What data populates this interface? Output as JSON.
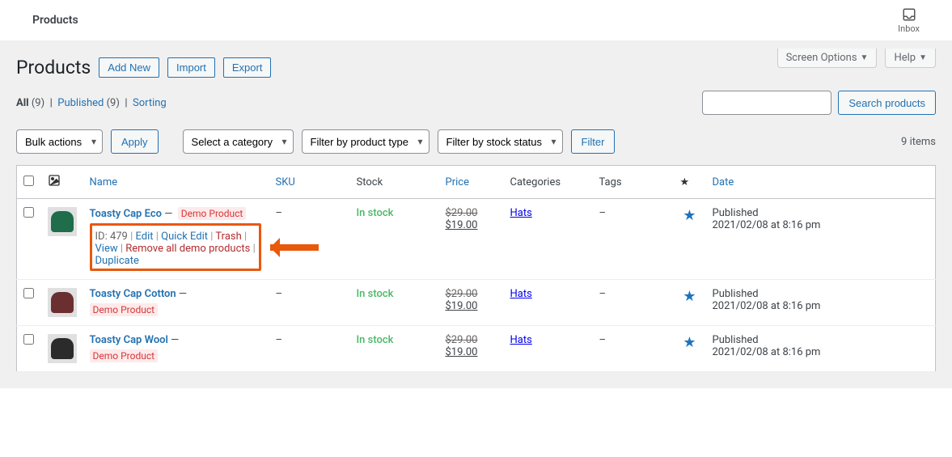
{
  "topbar": {
    "title": "Products",
    "inbox_label": "Inbox"
  },
  "screen_options": {
    "screen_options": "Screen Options",
    "help": "Help"
  },
  "page": {
    "heading": "Products",
    "btn_add_new": "Add New",
    "btn_import": "Import",
    "btn_export": "Export"
  },
  "views": {
    "all_label": "All",
    "all_count": "(9)",
    "published_label": "Published",
    "published_count": "(9)",
    "sorting_label": "Sorting"
  },
  "search": {
    "btn": "Search products"
  },
  "filters": {
    "bulk_actions": "Bulk actions",
    "apply": "Apply",
    "category": "Select a category",
    "product_type": "Filter by product type",
    "stock_status": "Filter by stock status",
    "filter_btn": "Filter",
    "items_label": "9 items"
  },
  "columns": {
    "name": "Name",
    "sku": "SKU",
    "stock": "Stock",
    "price": "Price",
    "categories": "Categories",
    "tags": "Tags",
    "date": "Date"
  },
  "row_actions": {
    "id_prefix": "ID: ",
    "edit": "Edit",
    "quick_edit": "Quick Edit",
    "trash": "Trash",
    "view": "View",
    "remove_demo": "Remove all demo products",
    "duplicate": "Duplicate"
  },
  "common": {
    "demo_badge": "Demo Product",
    "emdash": "—",
    "endash": "–",
    "sep": " | "
  },
  "rows": [
    {
      "id": "479",
      "title": "Toasty Cap Eco",
      "thumb_color": "#1f6d4a",
      "sku": "–",
      "stock": "In stock",
      "price_old": "$29.00",
      "price_new": "$19.00",
      "category": "Hats",
      "tags": "–",
      "date_line1": "Published",
      "date_line2": "2021/02/08 at 8:16 pm",
      "show_actions": true
    },
    {
      "title": "Toasty Cap Cotton",
      "thumb_color": "#6b2f2f",
      "sku": "–",
      "stock": "In stock",
      "price_old": "$29.00",
      "price_new": "$19.00",
      "category": "Hats",
      "tags": "–",
      "date_line1": "Published",
      "date_line2": "2021/02/08 at 8:16 pm",
      "show_actions": false
    },
    {
      "title": "Toasty Cap Wool",
      "thumb_color": "#2b2b2b",
      "sku": "–",
      "stock": "In stock",
      "price_old": "$29.00",
      "price_new": "$19.00",
      "category": "Hats",
      "tags": "–",
      "date_line1": "Published",
      "date_line2": "2021/02/08 at 8:16 pm",
      "show_actions": false
    }
  ]
}
